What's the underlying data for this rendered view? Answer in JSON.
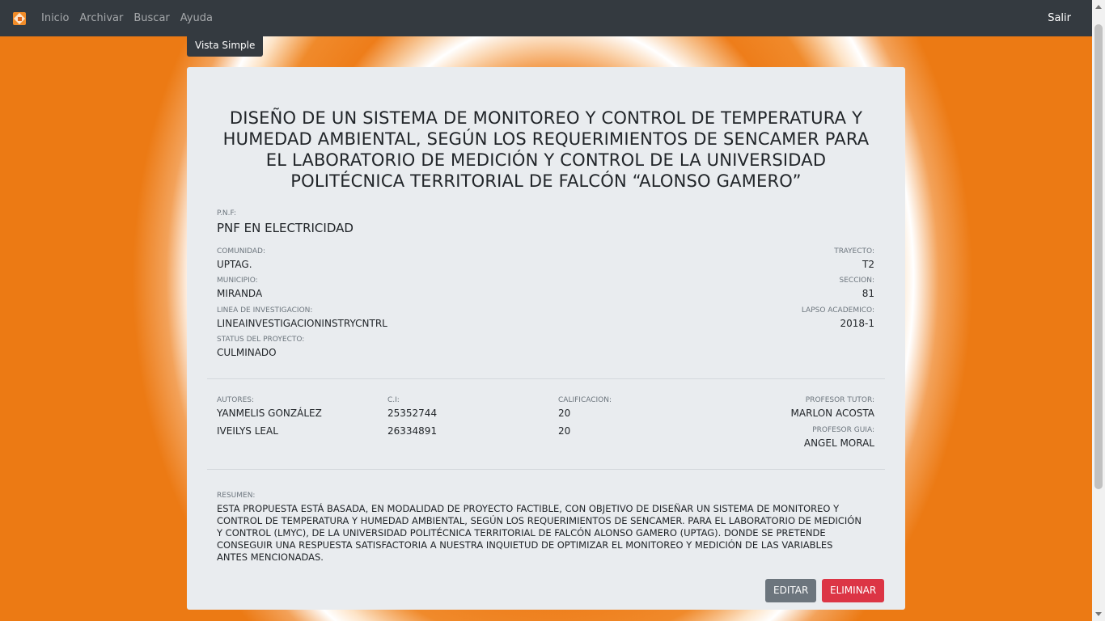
{
  "nav": {
    "items": [
      "Inicio",
      "Archivar",
      "Buscar",
      "Ayuda"
    ],
    "logout": "Salir"
  },
  "tab": "Vista Simple",
  "record": {
    "title": "DISEÑO DE UN SISTEMA DE MONITOREO Y CONTROL DE TEMPERATURA Y HUMEDAD AMBIENTAL, SEGÚN LOS REQUERIMIENTOS DE SENCAMER PARA EL LABORATORIO DE MEDICIÓN Y CONTROL DE LA UNIVERSIDAD POLITÉCNICA TERRITORIAL DE FALCÓN “ALONSO GAMERO”",
    "pnf_label": "P.N.F:",
    "pnf": "PNF EN ELECTRICIDAD",
    "comunidad_label": "COMUNIDAD:",
    "comunidad": "UPTAG.",
    "trayecto_label": "TRAYECTO:",
    "trayecto": "T2",
    "municipio_label": "MUNICIPIO:",
    "municipio": "MIRANDA",
    "seccion_label": "SECCION:",
    "seccion": "81",
    "linea_label": "LINEA DE INVESTIGACION:",
    "linea": "LINEAINVESTIGACIONINSTRYCNTRL",
    "lapso_label": "LAPSO ACADEMICO:",
    "lapso": "2018-1",
    "status_label": "STATUS DEL PROYECTO:",
    "status": "CULMINADO",
    "autores_label": "AUTORES:",
    "ci_label": "C.I:",
    "calificacion_label": "CALIFICACION:",
    "authors": [
      {
        "name": "YANMELIS GONZÁLEZ",
        "ci": "25352744",
        "grade": "20"
      },
      {
        "name": "IVEILYS LEAL",
        "ci": "26334891",
        "grade": "20"
      }
    ],
    "tutor_label": "PROFESOR TUTOR:",
    "tutor": "MARLON ACOSTA",
    "guia_label": "PROFESOR GUIA:",
    "guia": "ANGEL MORAL",
    "resumen_label": "RESUMEN:",
    "resumen": "ESTA PROPUESTA ESTÁ BASADA, EN MODALIDAD DE PROYECTO FACTIBLE, CON OBJETIVO DE DISEÑAR UN SISTEMA DE MONITOREO Y CONTROL DE TEMPERATURA Y HUMEDAD AMBIENTAL, SEGÚN LOS REQUERIMIENTOS DE SENCAMER. PARA EL LABORATORIO DE MEDICIÓN Y CONTROL (LMYC), DE LA UNIVERSIDAD POLITÉCNICA TERRITORIAL DE FALCÓN ALONSO GAMERO (UPTAG). DONDE SE PRETENDE CONSEGUIR UNA RESPUESTA SATISFACTORIA A NUESTRA INQUIETUD DE OPTIMIZAR EL MONITOREO Y MEDICIÓN DE LAS VARIABLES ANTES MENCIONADAS."
  },
  "actions": {
    "edit": "EDITAR",
    "delete": "ELIMINAR"
  },
  "colors": {
    "navbar": "#343a40",
    "card": "#e9ecef",
    "edit_button": "#6c757d",
    "delete_button": "#dc3545",
    "background_accent": "#ec7a14"
  }
}
